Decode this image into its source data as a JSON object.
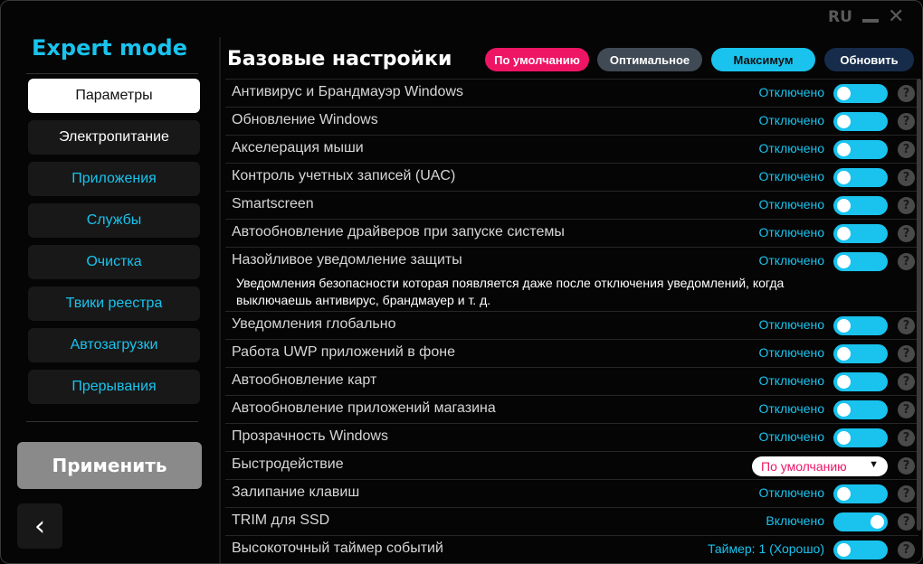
{
  "window": {
    "lang": "RU"
  },
  "sidebar": {
    "brand": "Expert mode",
    "items": [
      {
        "label": "Параметры"
      },
      {
        "label": "Электропитание"
      },
      {
        "label": "Приложения"
      },
      {
        "label": "Службы"
      },
      {
        "label": "Очистка"
      },
      {
        "label": "Твики реестра"
      },
      {
        "label": "Автозагрузки"
      },
      {
        "label": "Прерывания"
      }
    ],
    "apply_label": "Применить"
  },
  "header": {
    "title": "Базовые настройки",
    "presets": [
      "По умолчанию",
      "Оптимальное",
      "Максимум",
      "Обновить"
    ]
  },
  "settings": [
    {
      "label": "Антивирус и Брандмауэр Windows",
      "status": "Отключено",
      "state": "off"
    },
    {
      "label": "Обновление Windows",
      "status": "Отключено",
      "state": "off"
    },
    {
      "label": "Акселерация мыши",
      "status": "Отключено",
      "state": "off"
    },
    {
      "label": "Контроль учетных записей (UAC)",
      "status": "Отключено",
      "state": "off"
    },
    {
      "label": "Smartscreen",
      "status": "Отключено",
      "state": "off"
    },
    {
      "label": "Автообновление драйверов при запуске системы",
      "status": "Отключено",
      "state": "off"
    },
    {
      "label": "Назойливое уведомление защиты",
      "status": "Отключено",
      "state": "off"
    },
    {
      "label": "Уведомления глобально",
      "status": "Отключено",
      "state": "off"
    },
    {
      "label": "Работа UWP приложений в фоне",
      "status": "Отключено",
      "state": "off"
    },
    {
      "label": "Автообновление карт",
      "status": "Отключено",
      "state": "off"
    },
    {
      "label": "Автообновление приложений магазина",
      "status": "Отключено",
      "state": "off"
    },
    {
      "label": "Прозрачность Windows",
      "status": "Отключено",
      "state": "off"
    },
    {
      "label": "Быстродействие",
      "dropdown": "По умолчанию"
    },
    {
      "label": "Залипание клавиш",
      "status": "Отключено",
      "state": "off"
    },
    {
      "label": "TRIM для SSD",
      "status": "Включено",
      "state": "on"
    },
    {
      "label": "Высокоточный таймер событий",
      "status": "Таймер: 1 (Хорошо)",
      "state": "off"
    }
  ],
  "tooltip": {
    "line1": "Уведомления безопасности которая появляется даже после отключения уведомлений, когда",
    "line2": "выключаешь антивирус, брандмауер и т. д."
  },
  "colors": {
    "accent": "#19c3ee",
    "danger": "#ee1565"
  }
}
